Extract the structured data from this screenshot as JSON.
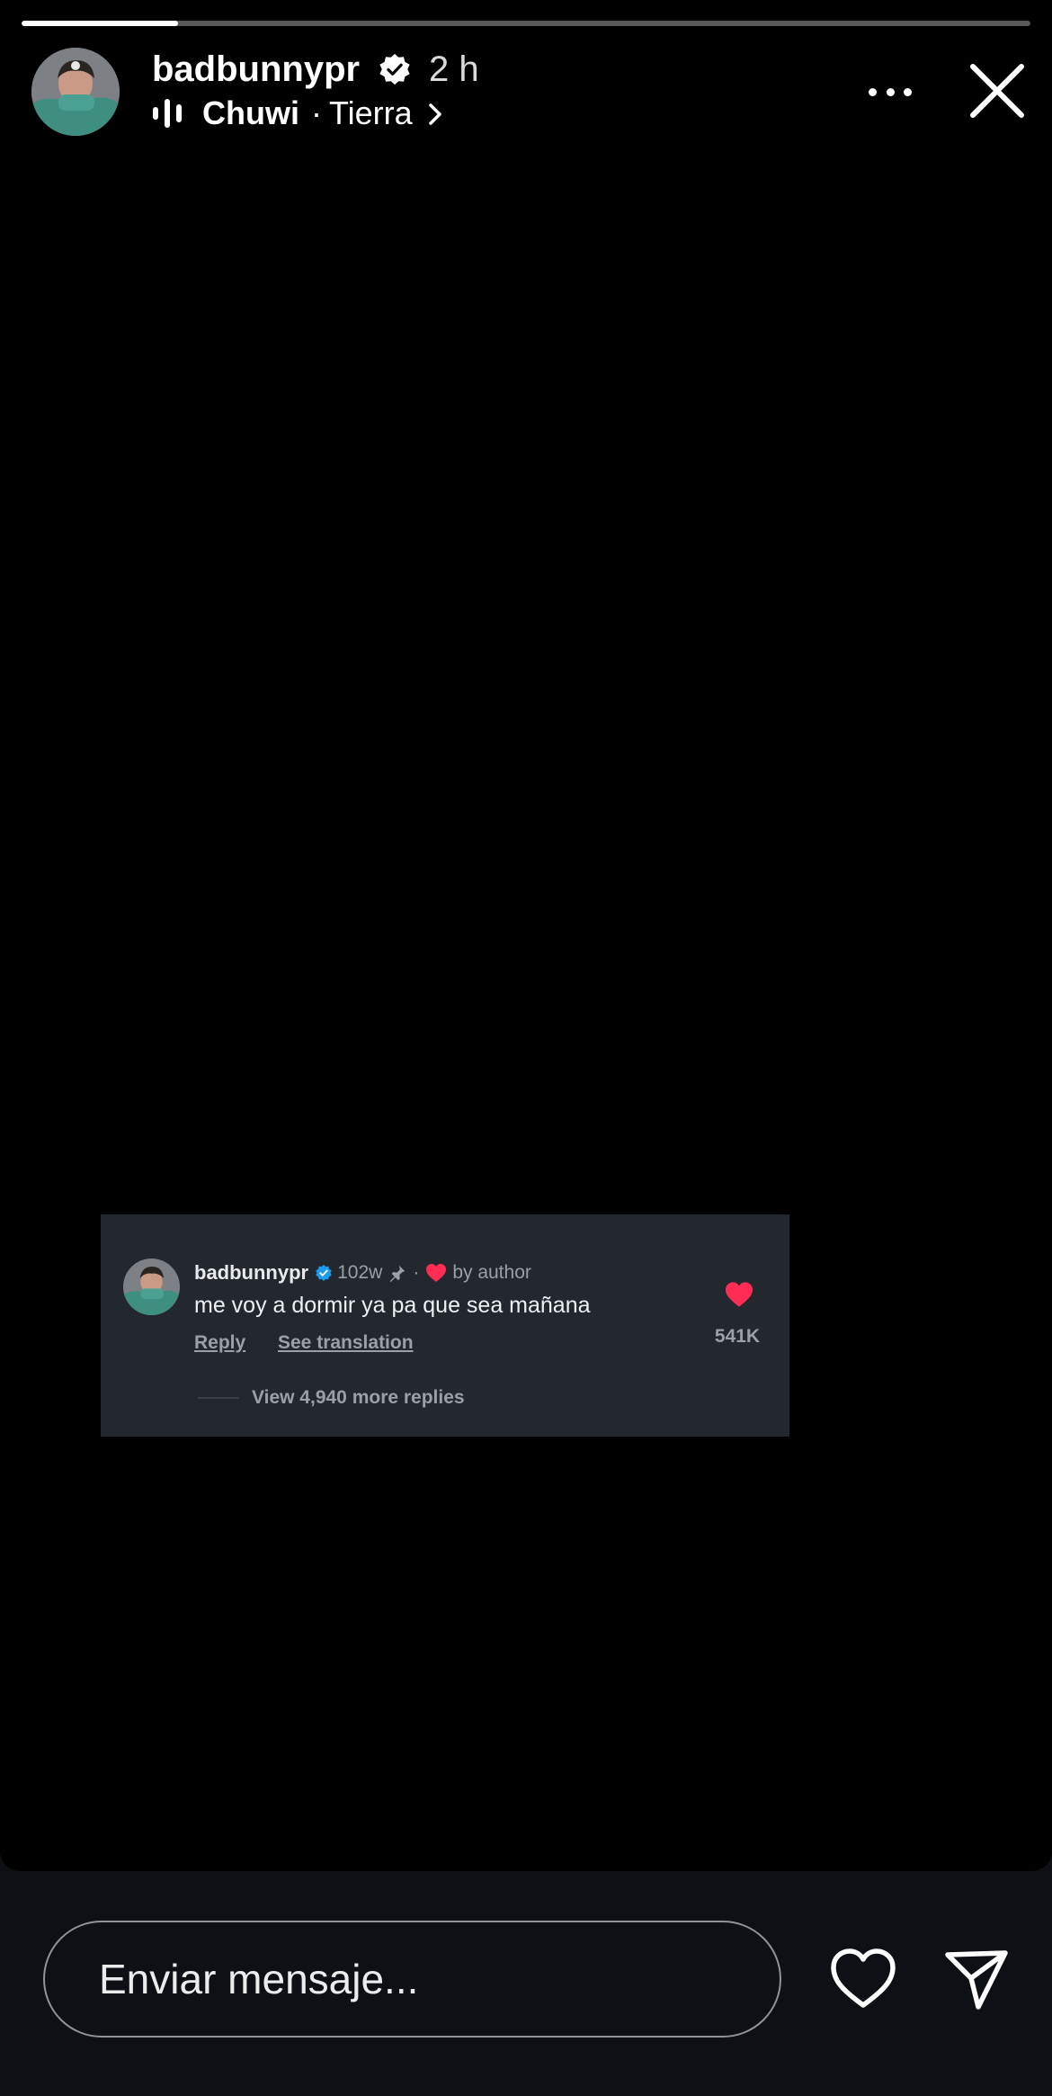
{
  "story": {
    "progress_fraction": 0.155,
    "username": "badbunnypr",
    "verified": true,
    "time_ago": "2 h",
    "song": {
      "title": "Chuwi",
      "separator": "·",
      "artist": "Tierra"
    }
  },
  "comment": {
    "username": "badbunnypr",
    "age": "102w",
    "dot": "·",
    "liked_by": "by author",
    "text": "me voy a dormir ya pa que sea mañana",
    "reply_label": "Reply",
    "translation_label": "See translation",
    "like_count": "541K",
    "view_replies_label": "View 4,940 more replies"
  },
  "composer": {
    "placeholder": "Enviar mensaje..."
  },
  "colors": {
    "story_background": "#000000",
    "bottom_bar": "#0d1015",
    "comment_card": "#23272e",
    "heart_red": "#ff2d55",
    "verified_blue": "#1d9bf0"
  },
  "icons": {
    "verified": "verified-badge-icon",
    "music": "music-bars-icon",
    "more": "more-dots-icon",
    "close": "close-icon",
    "pin": "pin-icon",
    "like": "heart-icon",
    "send": "send-icon"
  }
}
